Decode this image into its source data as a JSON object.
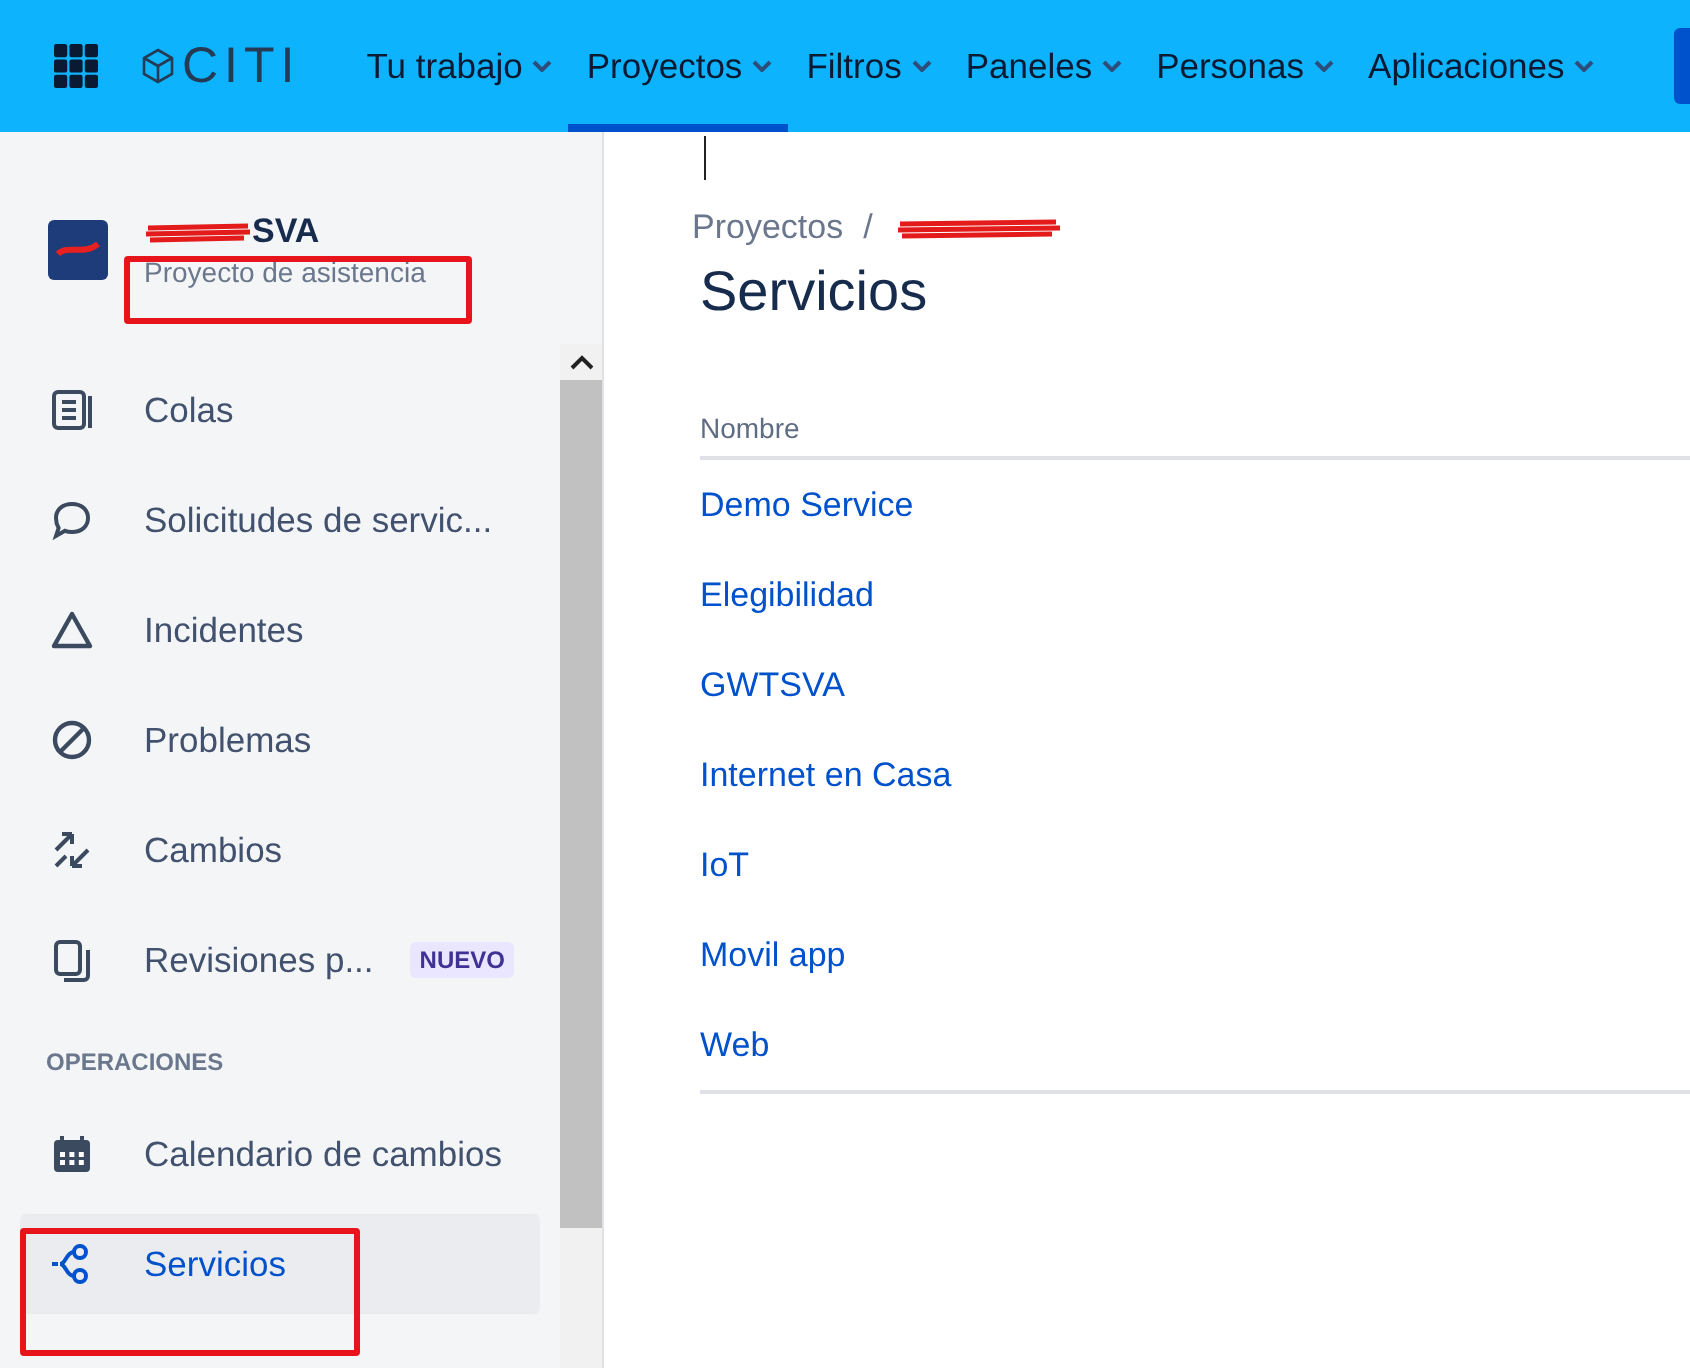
{
  "topbar": {
    "logo": "CITI",
    "nav": [
      {
        "label": "Tu trabajo",
        "selected": false
      },
      {
        "label": "Proyectos",
        "selected": true
      },
      {
        "label": "Filtros",
        "selected": false
      },
      {
        "label": "Paneles",
        "selected": false
      },
      {
        "label": "Personas",
        "selected": false
      },
      {
        "label": "Aplicaciones",
        "selected": false
      }
    ]
  },
  "sidebar": {
    "project": {
      "name": "SVA",
      "type": "Proyecto de asistencia"
    },
    "items": [
      {
        "kind": "queue",
        "label": "Colas",
        "selected": false
      },
      {
        "kind": "chat",
        "label": "Solicitudes de servic...",
        "selected": false
      },
      {
        "kind": "triangle",
        "label": "Incidentes",
        "selected": false
      },
      {
        "kind": "ban",
        "label": "Problemas",
        "selected": false
      },
      {
        "kind": "arrows",
        "label": "Cambios",
        "selected": false
      },
      {
        "kind": "pages",
        "label": "Revisiones p...",
        "selected": false,
        "badge": "NUEVO"
      }
    ],
    "section": "OPERACIONES",
    "section_items": [
      {
        "kind": "calendar",
        "label": "Calendario de cambios",
        "selected": false
      },
      {
        "kind": "services",
        "label": "Servicios",
        "selected": true
      }
    ]
  },
  "main": {
    "breadcrumb": [
      "Proyectos"
    ],
    "breadcrumb_separator": "/",
    "title": "Servicios",
    "table": {
      "columns": [
        "Nombre"
      ],
      "rows": [
        "Demo Service",
        "Elegibilidad",
        "GWTSVA",
        "Internet en Casa",
        "IoT",
        "Movil app",
        "Web"
      ]
    }
  }
}
